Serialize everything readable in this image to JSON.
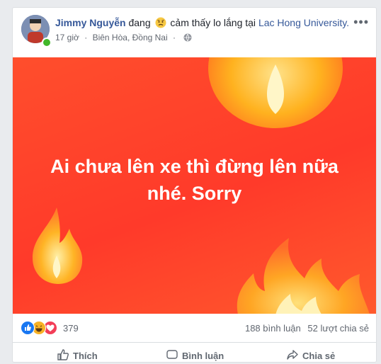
{
  "post": {
    "author": "Jimmy Nguyễn",
    "verb": "đang",
    "feeling_emoji": "worried-face-icon",
    "feeling": "cảm thấy lo lắng tại",
    "place": "Lac Hong University.",
    "time": "17 giờ",
    "location": "Biên Hòa, Đồng Nai",
    "privacy_icon": "globe-icon",
    "more_label": "•••",
    "text_line1": "Ai chưa lên xe thì đừng lên nữa",
    "text_line2": "nhé. Sorry",
    "background": {
      "from": "#ff4e2c",
      "to": "#ff5a2d"
    }
  },
  "stats": {
    "reactions": [
      "like-icon",
      "haha-icon",
      "love-icon"
    ],
    "reaction_count": "379",
    "comments": "188 bình luận",
    "shares": "52 lượt chia sẻ"
  },
  "actions": {
    "like": "Thích",
    "comment": "Bình luận",
    "share": "Chia sẻ"
  },
  "colors": {
    "link": "#365899",
    "meta": "#616770",
    "like_blue": "#1877f2",
    "love_red": "#f33e58",
    "haha_yellow": "#f7b125"
  }
}
